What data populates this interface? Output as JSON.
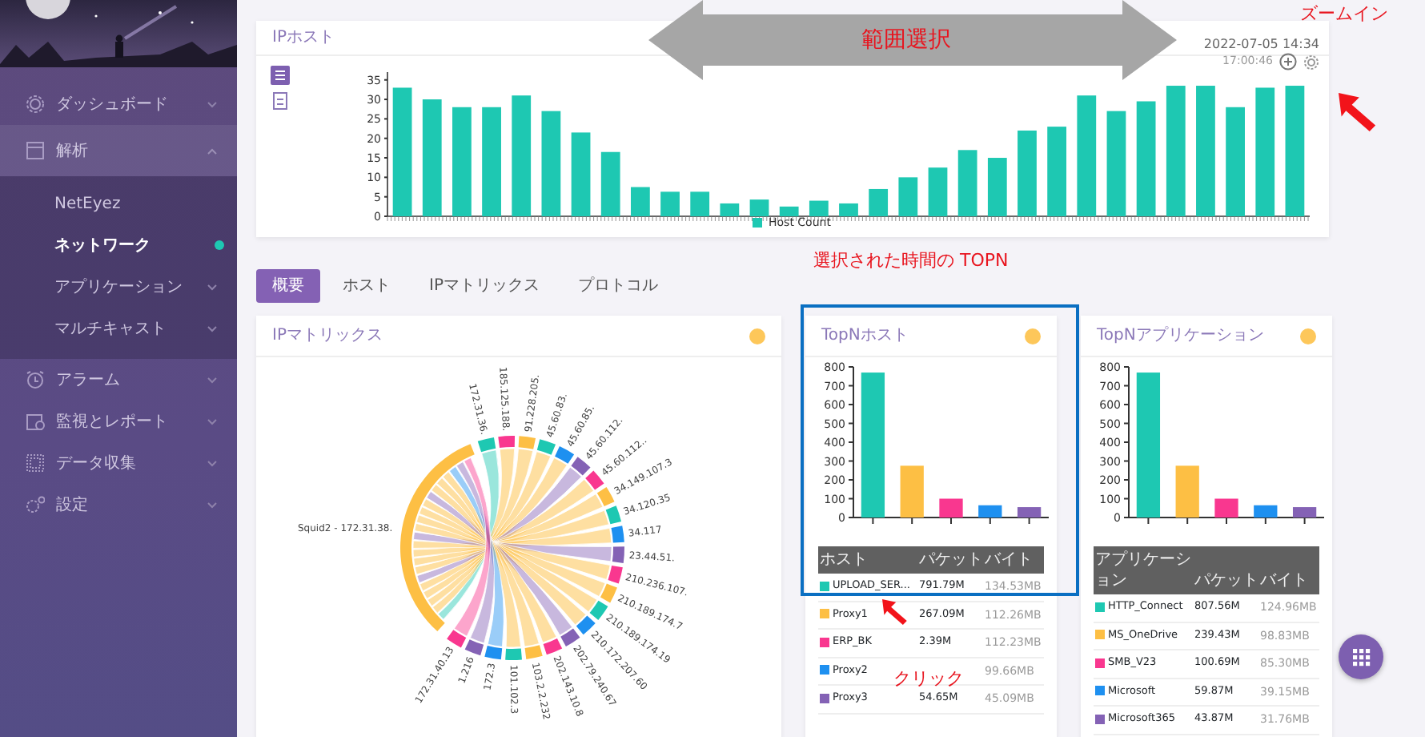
{
  "sidebar": {
    "items": [
      {
        "label": "ダッシュボード",
        "expanded": false
      },
      {
        "label": "解析",
        "expanded": true,
        "children": [
          {
            "label": "NetEyez",
            "selected": false
          },
          {
            "label": "ネットワーク",
            "selected": true
          },
          {
            "label": "アプリケーション",
            "selected": false,
            "expanded": false
          },
          {
            "label": "マルチキャスト",
            "selected": false,
            "expanded": false
          }
        ]
      },
      {
        "label": "アラーム",
        "expanded": false
      },
      {
        "label": "監視とレポート",
        "expanded": false
      },
      {
        "label": "データ収集",
        "expanded": false
      },
      {
        "label": "設定",
        "expanded": false
      }
    ]
  },
  "ip_host": {
    "title": "IPホスト",
    "timestamp": "2022-07-05 14:34",
    "range_end": "17:00:46",
    "chart_data": {
      "type": "bar",
      "ylim": [
        0,
        37
      ],
      "yticks": [
        0,
        5,
        10,
        15,
        20,
        25,
        30,
        35
      ],
      "series": [
        {
          "name": "Host Count",
          "color": "#1ec8b2",
          "values": [
            33,
            30,
            28,
            28,
            31,
            27,
            21.5,
            16.5,
            7.5,
            6.3,
            6.3,
            3.3,
            4.3,
            2.5,
            4,
            3.3,
            7,
            10,
            12.5,
            17,
            15,
            22,
            23,
            31,
            27,
            29.5,
            33.5,
            33.5,
            28,
            33,
            33.5
          ]
        }
      ]
    }
  },
  "tabs": [
    {
      "label": "概要",
      "selected": true
    },
    {
      "label": "ホスト",
      "selected": false
    },
    {
      "label": "IPマトリックス",
      "selected": false
    },
    {
      "label": "プロトコル",
      "selected": false
    }
  ],
  "ip_matrix": {
    "title": "IPマトリックス",
    "nodes": [
      {
        "label": "Squid2 - 172.31.38.",
        "kind": "main",
        "color": "#fdbf44"
      },
      {
        "label": "172.31.36.",
        "kind": "peer",
        "color": "#1ec8b2"
      },
      {
        "label": "185.125.188.",
        "kind": "peer",
        "color": "#f9378f"
      },
      {
        "label": "91.228.205.",
        "kind": "peer",
        "color": "#fdbf44"
      },
      {
        "label": "45.60.83.",
        "kind": "peer",
        "color": "#1ec8b2"
      },
      {
        "label": "45.60.85.",
        "kind": "peer",
        "color": "#1e90f0"
      },
      {
        "label": "45.60.112.",
        "kind": "peer",
        "color": "#8462b5"
      },
      {
        "label": "45.60.112..",
        "kind": "peer",
        "color": "#f9378f"
      },
      {
        "label": "34.149.107.3",
        "kind": "peer",
        "color": "#fdbf44"
      },
      {
        "label": "34.120.35",
        "kind": "peer",
        "color": "#1ec8b2"
      },
      {
        "label": "34.117",
        "kind": "peer",
        "color": "#1e90f0"
      },
      {
        "label": "23.44.51.",
        "kind": "peer",
        "color": "#8462b5"
      },
      {
        "label": "210.236.107.",
        "kind": "peer",
        "color": "#f9378f"
      },
      {
        "label": "210.189.174.7",
        "kind": "peer",
        "color": "#fdbf44"
      },
      {
        "label": "210.189.174.19",
        "kind": "peer",
        "color": "#1ec8b2"
      },
      {
        "label": "210.172.207.60",
        "kind": "peer",
        "color": "#1e90f0"
      },
      {
        "label": "202.79.240.67",
        "kind": "peer",
        "color": "#8462b5"
      },
      {
        "label": "202.143.10.8",
        "kind": "peer",
        "color": "#f9378f"
      },
      {
        "label": "103.2.2.232",
        "kind": "peer",
        "color": "#fdbf44"
      },
      {
        "label": "101.102.3",
        "kind": "peer",
        "color": "#1ec8b2"
      },
      {
        "label": "172.3",
        "kind": "peer",
        "color": "#1e90f0"
      },
      {
        "label": "1.216",
        "kind": "peer",
        "color": "#8462b5"
      },
      {
        "label": "172.31.40.13",
        "kind": "peer",
        "color": "#f9378f"
      }
    ]
  },
  "topn_hosts": {
    "title": "TopNホスト",
    "chart_data": {
      "type": "bar",
      "ylim": [
        0,
        800
      ],
      "yticks": [
        0,
        100,
        200,
        300,
        400,
        500,
        600,
        700,
        800
      ],
      "series": [
        {
          "values": [
            770,
            275,
            100,
            65,
            55
          ]
        }
      ]
    },
    "columns": [
      "ホスト",
      "パケット",
      "バイト"
    ],
    "rows": [
      {
        "color": "#1ec8b2",
        "name": "UPLOAD_SER...",
        "packets": "791.79M",
        "bytes": "134.53MB"
      },
      {
        "color": "#fdbf44",
        "name": "Proxy1",
        "packets": "267.09M",
        "bytes": "112.26MB"
      },
      {
        "color": "#f9378f",
        "name": "ERP_BK",
        "packets": "2.39M",
        "bytes": "112.23MB"
      },
      {
        "color": "#1e90f0",
        "name": "Proxy2",
        "bytes": "99.66MB"
      },
      {
        "color": "#8462b5",
        "name": "Proxy3",
        "packets": "54.65M",
        "bytes": "45.09MB"
      }
    ]
  },
  "topn_apps": {
    "title": "TopNアプリケーション",
    "chart_data": {
      "type": "bar",
      "ylim": [
        0,
        800
      ],
      "yticks": [
        0,
        100,
        200,
        300,
        400,
        500,
        600,
        700,
        800
      ],
      "series": [
        {
          "values": [
            770,
            275,
            100,
            65,
            55
          ]
        }
      ]
    },
    "columns": [
      "アプリケーション",
      "パケット",
      "バイト"
    ],
    "rows": [
      {
        "color": "#1ec8b2",
        "name": "HTTP_Connect",
        "packets": "807.56M",
        "bytes": "124.96MB"
      },
      {
        "color": "#fdbf44",
        "name": "MS_OneDrive",
        "packets": "239.43M",
        "bytes": "98.83MB"
      },
      {
        "color": "#f9378f",
        "name": "SMB_V23",
        "packets": "100.69M",
        "bytes": "85.30MB"
      },
      {
        "color": "#1e90f0",
        "name": "Microsoft",
        "packets": "59.87M",
        "bytes": "39.15MB"
      },
      {
        "color": "#8462b5",
        "name": "Microsoft365",
        "packets": "43.87M",
        "bytes": "31.76MB"
      }
    ]
  },
  "annotations": {
    "range_label": "範囲選択",
    "zoom_label": "ズームイン",
    "topn_label": "選択された時間の TOPN",
    "click_label": "クリック"
  }
}
